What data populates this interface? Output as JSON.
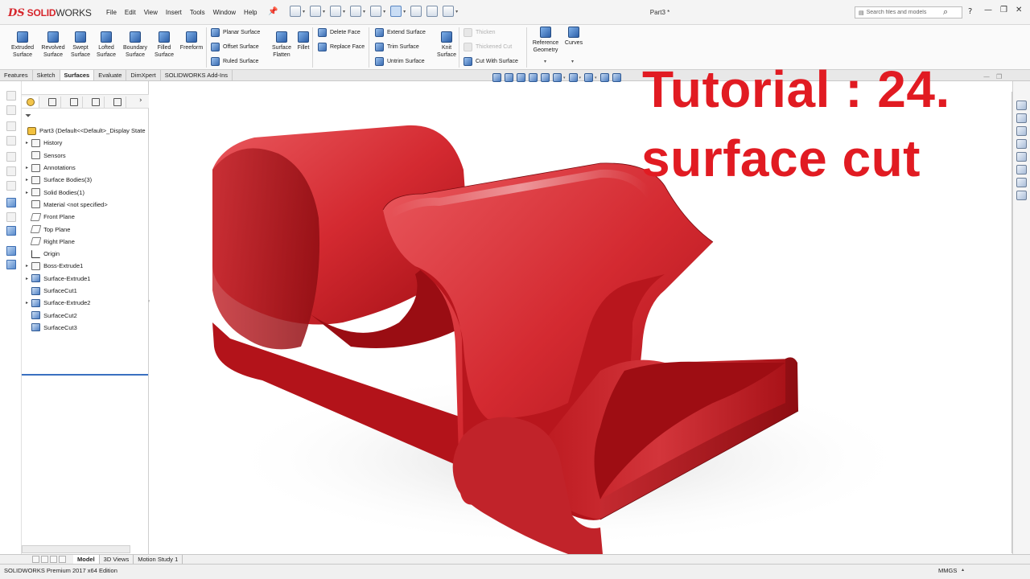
{
  "app": {
    "logo_ds": "DS",
    "logo_solid": "SOLID",
    "logo_works": "WORKS",
    "doc_title": "Part3 *"
  },
  "menu": [
    "File",
    "Edit",
    "View",
    "Insert",
    "Tools",
    "Window",
    "Help"
  ],
  "search": {
    "placeholder": "Search files and models"
  },
  "help_icon": "?",
  "window_controls": {
    "minimize": "—",
    "restore": "❐",
    "close": "✕"
  },
  "ribbon": {
    "large_tools": [
      {
        "label": "Extruded\nSurface"
      },
      {
        "label": "Revolved\nSurface"
      },
      {
        "label": "Swept\nSurface"
      },
      {
        "label": "Lofted\nSurface"
      },
      {
        "label": "Boundary\nSurface"
      },
      {
        "label": "Filled\nSurface"
      },
      {
        "label": "Freeform"
      }
    ],
    "col1": [
      "Planar Surface",
      "Offset Surface",
      "Ruled Surface"
    ],
    "surface_flatten": "Surface\nFlatten",
    "fillet": "Fillet",
    "col2": [
      "Delete Face",
      "Replace Face"
    ],
    "col3": [
      "Extend Surface",
      "Trim Surface",
      "Untrim Surface"
    ],
    "knit_surface": "Knit\nSurface",
    "col4": [
      "Thicken",
      "Thickened Cut",
      "Cut With Surface"
    ],
    "reference_geometry": "Reference\nGeometry",
    "curves": "Curves"
  },
  "tabs": [
    "Features",
    "Sketch",
    "Surfaces",
    "Evaluate",
    "DimXpert",
    "SOLIDWORKS Add-Ins"
  ],
  "active_tab": "Surfaces",
  "tree": {
    "root": "Part3  (Default<<Default>_Display State",
    "items": [
      {
        "label": "History",
        "expand": "▸",
        "icon": "folder"
      },
      {
        "label": "Sensors",
        "expand": "",
        "icon": "folder"
      },
      {
        "label": "Annotations",
        "expand": "▸",
        "icon": "folder"
      },
      {
        "label": "Surface Bodies(3)",
        "expand": "▸",
        "icon": "folder"
      },
      {
        "label": "Solid Bodies(1)",
        "expand": "▸",
        "icon": "folder"
      },
      {
        "label": "Material <not specified>",
        "expand": "",
        "icon": "material"
      },
      {
        "label": "Front Plane",
        "expand": "",
        "icon": "plane"
      },
      {
        "label": "Top Plane",
        "expand": "",
        "icon": "plane"
      },
      {
        "label": "Right Plane",
        "expand": "",
        "icon": "plane"
      },
      {
        "label": "Origin",
        "expand": "",
        "icon": "origin"
      },
      {
        "label": "Boss-Extrude1",
        "expand": "▸",
        "icon": "feature"
      },
      {
        "label": "Surface-Extrude1",
        "expand": "▸",
        "icon": "surface"
      },
      {
        "label": "SurfaceCut1",
        "expand": "",
        "icon": "surface"
      },
      {
        "label": "Surface-Extrude2",
        "expand": "▸",
        "icon": "surface"
      },
      {
        "label": "SurfaceCut2",
        "expand": "",
        "icon": "surface"
      },
      {
        "label": "SurfaceCut3",
        "expand": "",
        "icon": "surface"
      }
    ]
  },
  "bottom_tabs": [
    "Model",
    "3D Views",
    "Motion Study 1"
  ],
  "active_bottom_tab": "Model",
  "status": {
    "text": "SOLIDWORKS Premium 2017 x64 Edition",
    "units": "MMGS"
  },
  "overlay": {
    "line1": "Tutorial : 24.",
    "line2": "surface cut",
    "color": "#e11b22"
  },
  "colors": {
    "model_red": "#c8161d",
    "accent_blue": "#3a70c0"
  }
}
